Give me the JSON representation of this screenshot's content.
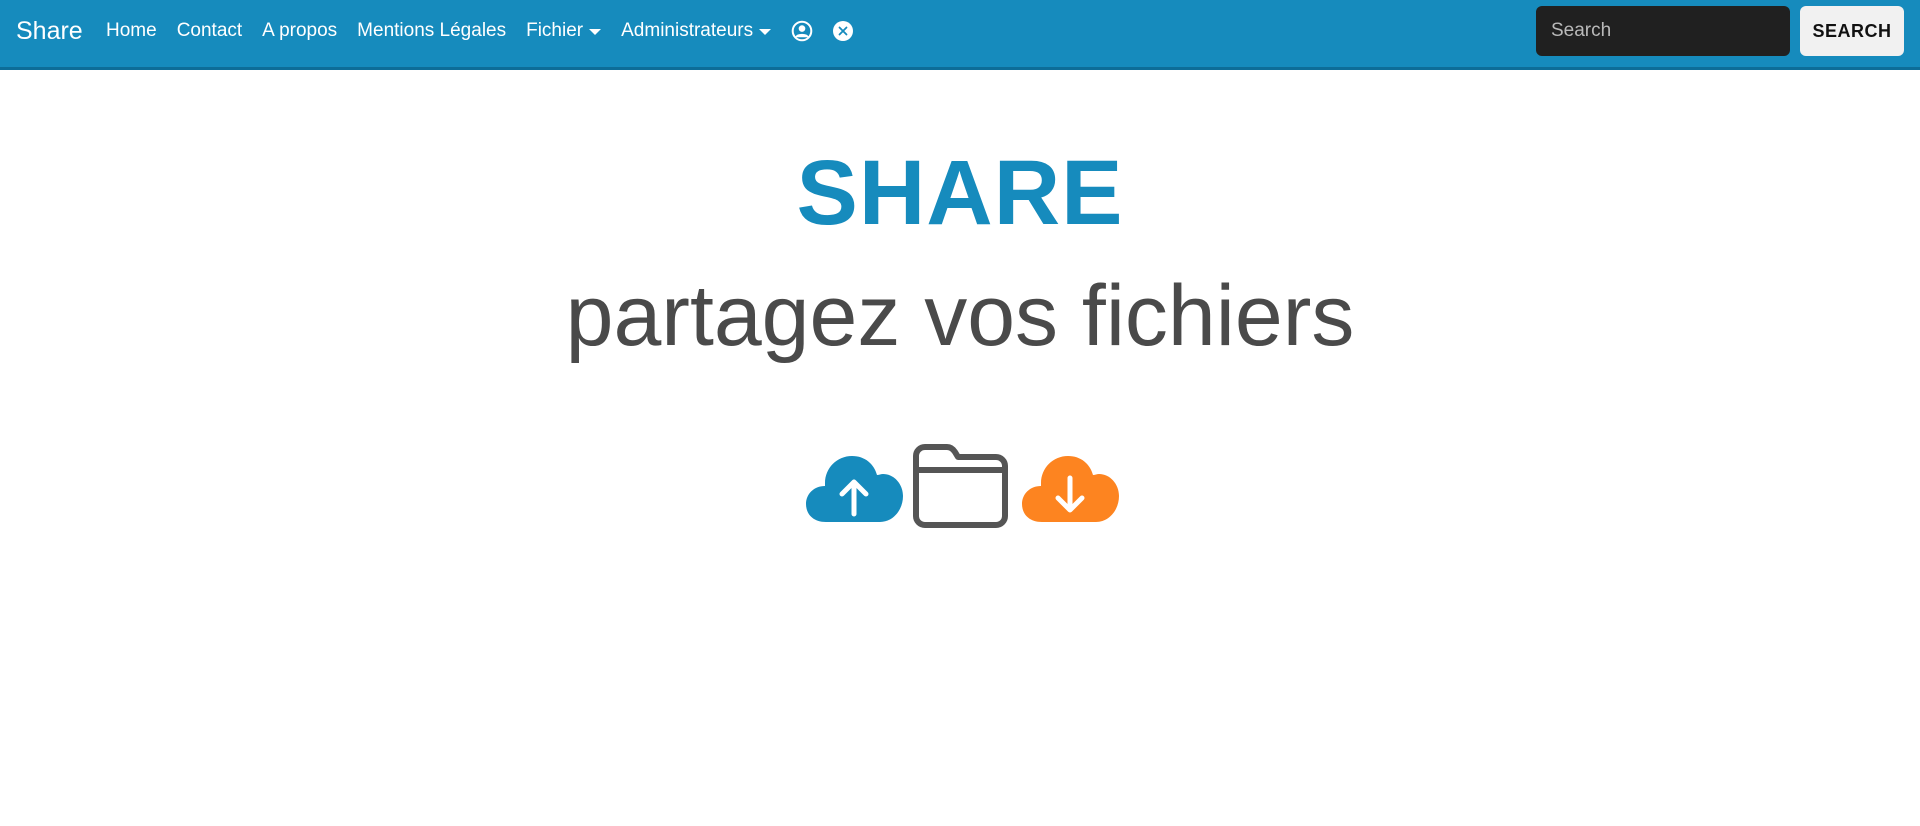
{
  "navbar": {
    "brand": "Share",
    "links": [
      "Home",
      "Contact",
      "A propos",
      "Mentions Légales"
    ],
    "dropdowns": [
      "Fichier",
      "Administrateurs"
    ],
    "icons": [
      "user-circle-icon",
      "close-circle-icon"
    ],
    "background_color": "#168bbd"
  },
  "search": {
    "placeholder": "Search",
    "value": "",
    "button_label": "SEARCH"
  },
  "hero": {
    "title": "SHARE",
    "subtitle": "partagez vos fichiers",
    "title_color": "#168bbd",
    "icons": [
      "cloud-upload-icon",
      "folder-icon",
      "cloud-download-icon"
    ],
    "upload_color": "#168bbd",
    "folder_color": "#555555",
    "download_color": "#fd8420"
  }
}
